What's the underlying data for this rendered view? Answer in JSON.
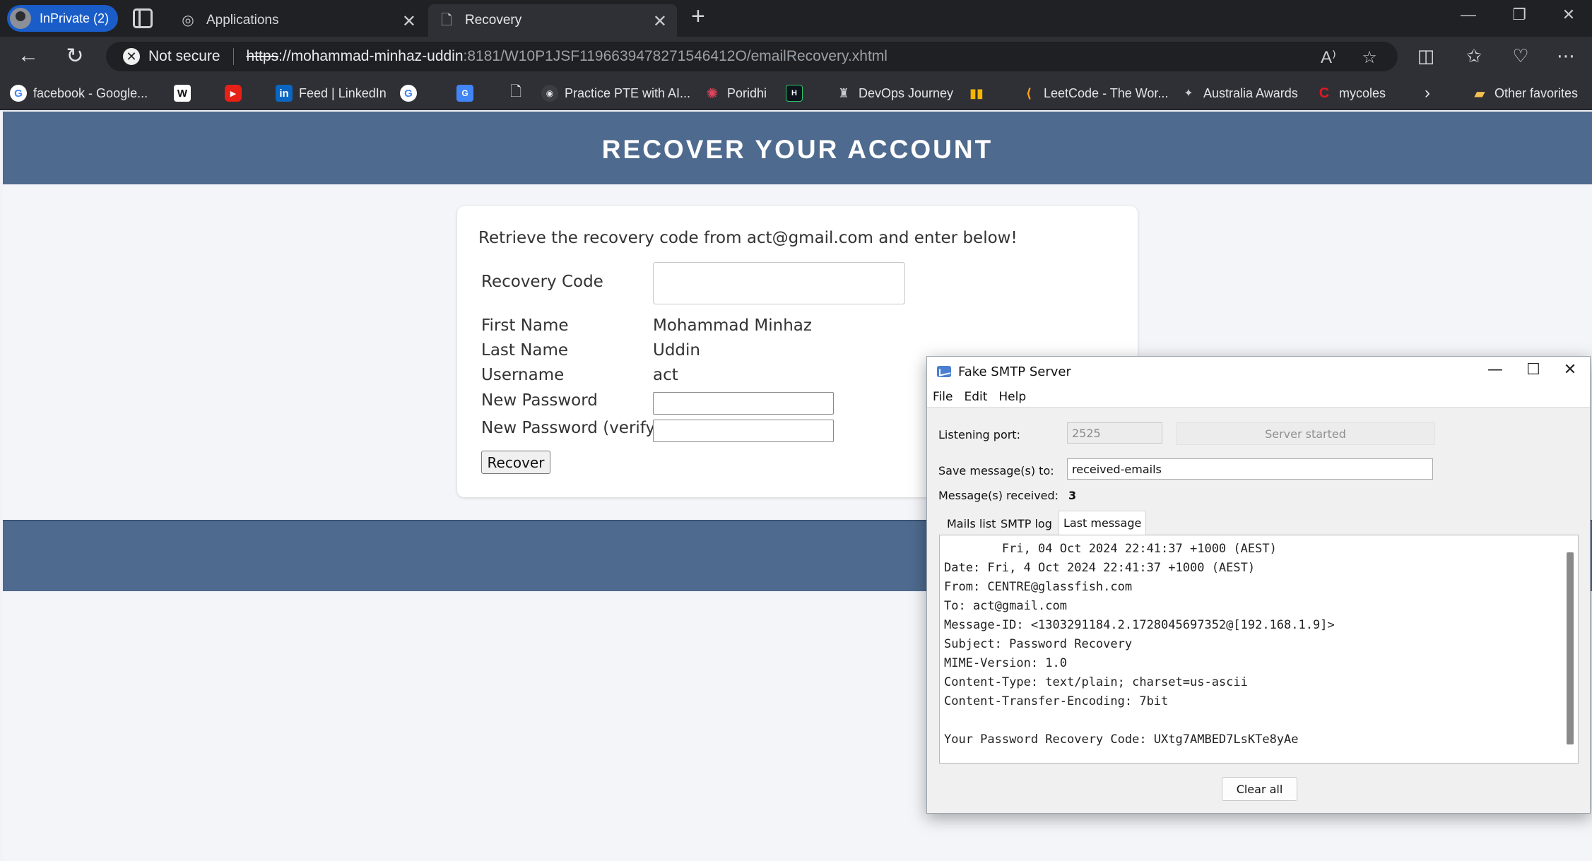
{
  "browser": {
    "inprivate_label": "InPrivate (2)",
    "tabs": [
      {
        "title": "Applications"
      },
      {
        "title": "Recovery"
      }
    ],
    "address": {
      "security_label": "Not secure",
      "url_protocol": "https",
      "url_host": "://mohammad-minhaz-uddin",
      "url_path": ":8181/W10P1JSF1196639478271546412O/emailRecovery.xhtml"
    },
    "bookmarks": [
      {
        "label": "facebook - Google..."
      },
      {
        "label": "Feed | LinkedIn"
      },
      {
        "label": "Practice PTE with AI..."
      },
      {
        "label": "Poridhi"
      },
      {
        "label": "DevOps Journey"
      },
      {
        "label": "LeetCode - The Wor..."
      },
      {
        "label": "Australia Awards"
      },
      {
        "label": "mycoles"
      },
      {
        "label": "Other favorites"
      }
    ]
  },
  "page": {
    "header_title": "RECOVER YOUR ACCOUNT",
    "instruction": "Retrieve the recovery code from act@gmail.com and enter below!",
    "fields": {
      "recovery_code_label": "Recovery Code",
      "first_name_label": "First Name",
      "first_name_value": "Mohammad Minhaz",
      "last_name_label": "Last Name",
      "last_name_value": "Uddin",
      "username_label": "Username",
      "username_value": "act",
      "new_password_label": "New Password",
      "new_password_verify_label": "New Password (verify)"
    },
    "recover_button": "Recover"
  },
  "smtp_window": {
    "title": "Fake SMTP Server",
    "menu": [
      "File",
      "Edit",
      "Help"
    ],
    "listening_port_label": "Listening port:",
    "listening_port_value": "2525",
    "server_status_button": "Server started",
    "save_to_label": "Save message(s) to:",
    "save_to_value": "received-emails",
    "received_label": "Message(s) received:",
    "received_count": "3",
    "tabs": [
      "Mails list",
      "SMTP log",
      "Last message"
    ],
    "message_lines": [
      "        Fri, 04 Oct 2024 22:41:37 +1000 (AEST)",
      "Date: Fri, 4 Oct 2024 22:41:37 +1000 (AEST)",
      "From: CENTRE@glassfish.com",
      "To: act@gmail.com",
      "Message-ID: <1303291184.2.1728045697352@[192.168.1.9]>",
      "Subject: Password Recovery",
      "MIME-Version: 1.0",
      "Content-Type: text/plain; charset=us-ascii",
      "Content-Transfer-Encoding: 7bit",
      "",
      "Your Password Recovery Code: UXtg7AMBED7LsKTe8yAe"
    ],
    "clear_button": "Clear all"
  }
}
